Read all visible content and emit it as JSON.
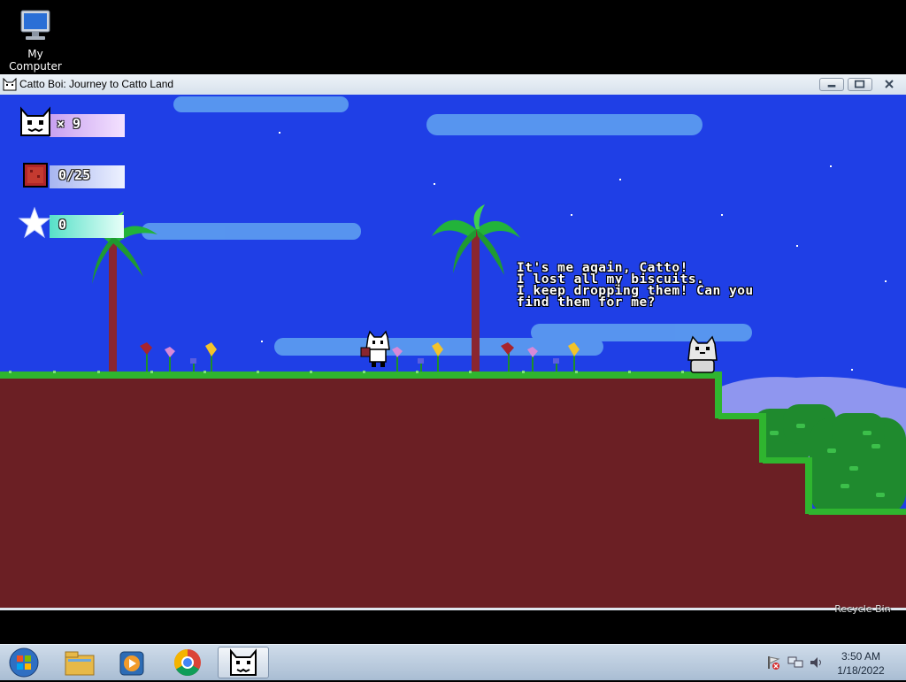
{
  "desktop": {
    "my_computer_label": "My Computer",
    "recycle_bin_label": "Recycle Bin"
  },
  "window": {
    "title": "Catto Boi: Journey to Catto Land"
  },
  "hud": {
    "lives": "× 9",
    "biscuits": "0/25",
    "stars": "0"
  },
  "dialogue": {
    "lines": [
      "It's me again, Catto!",
      "I lost all my biscuits.",
      "I keep dropping them! Can you",
      "find them for me?"
    ]
  },
  "taskbar": {
    "time": "3:50 AM",
    "date": "1/18/2022",
    "apps": [
      "start-button",
      "file-explorer-icon",
      "media-player-icon",
      "chrome-icon",
      "catto-game-icon"
    ]
  },
  "colors": {
    "sky": "#1f3fe6",
    "ground": "#6b1f24",
    "grass": "#2fb52f",
    "bush": "#1f8a2e"
  }
}
